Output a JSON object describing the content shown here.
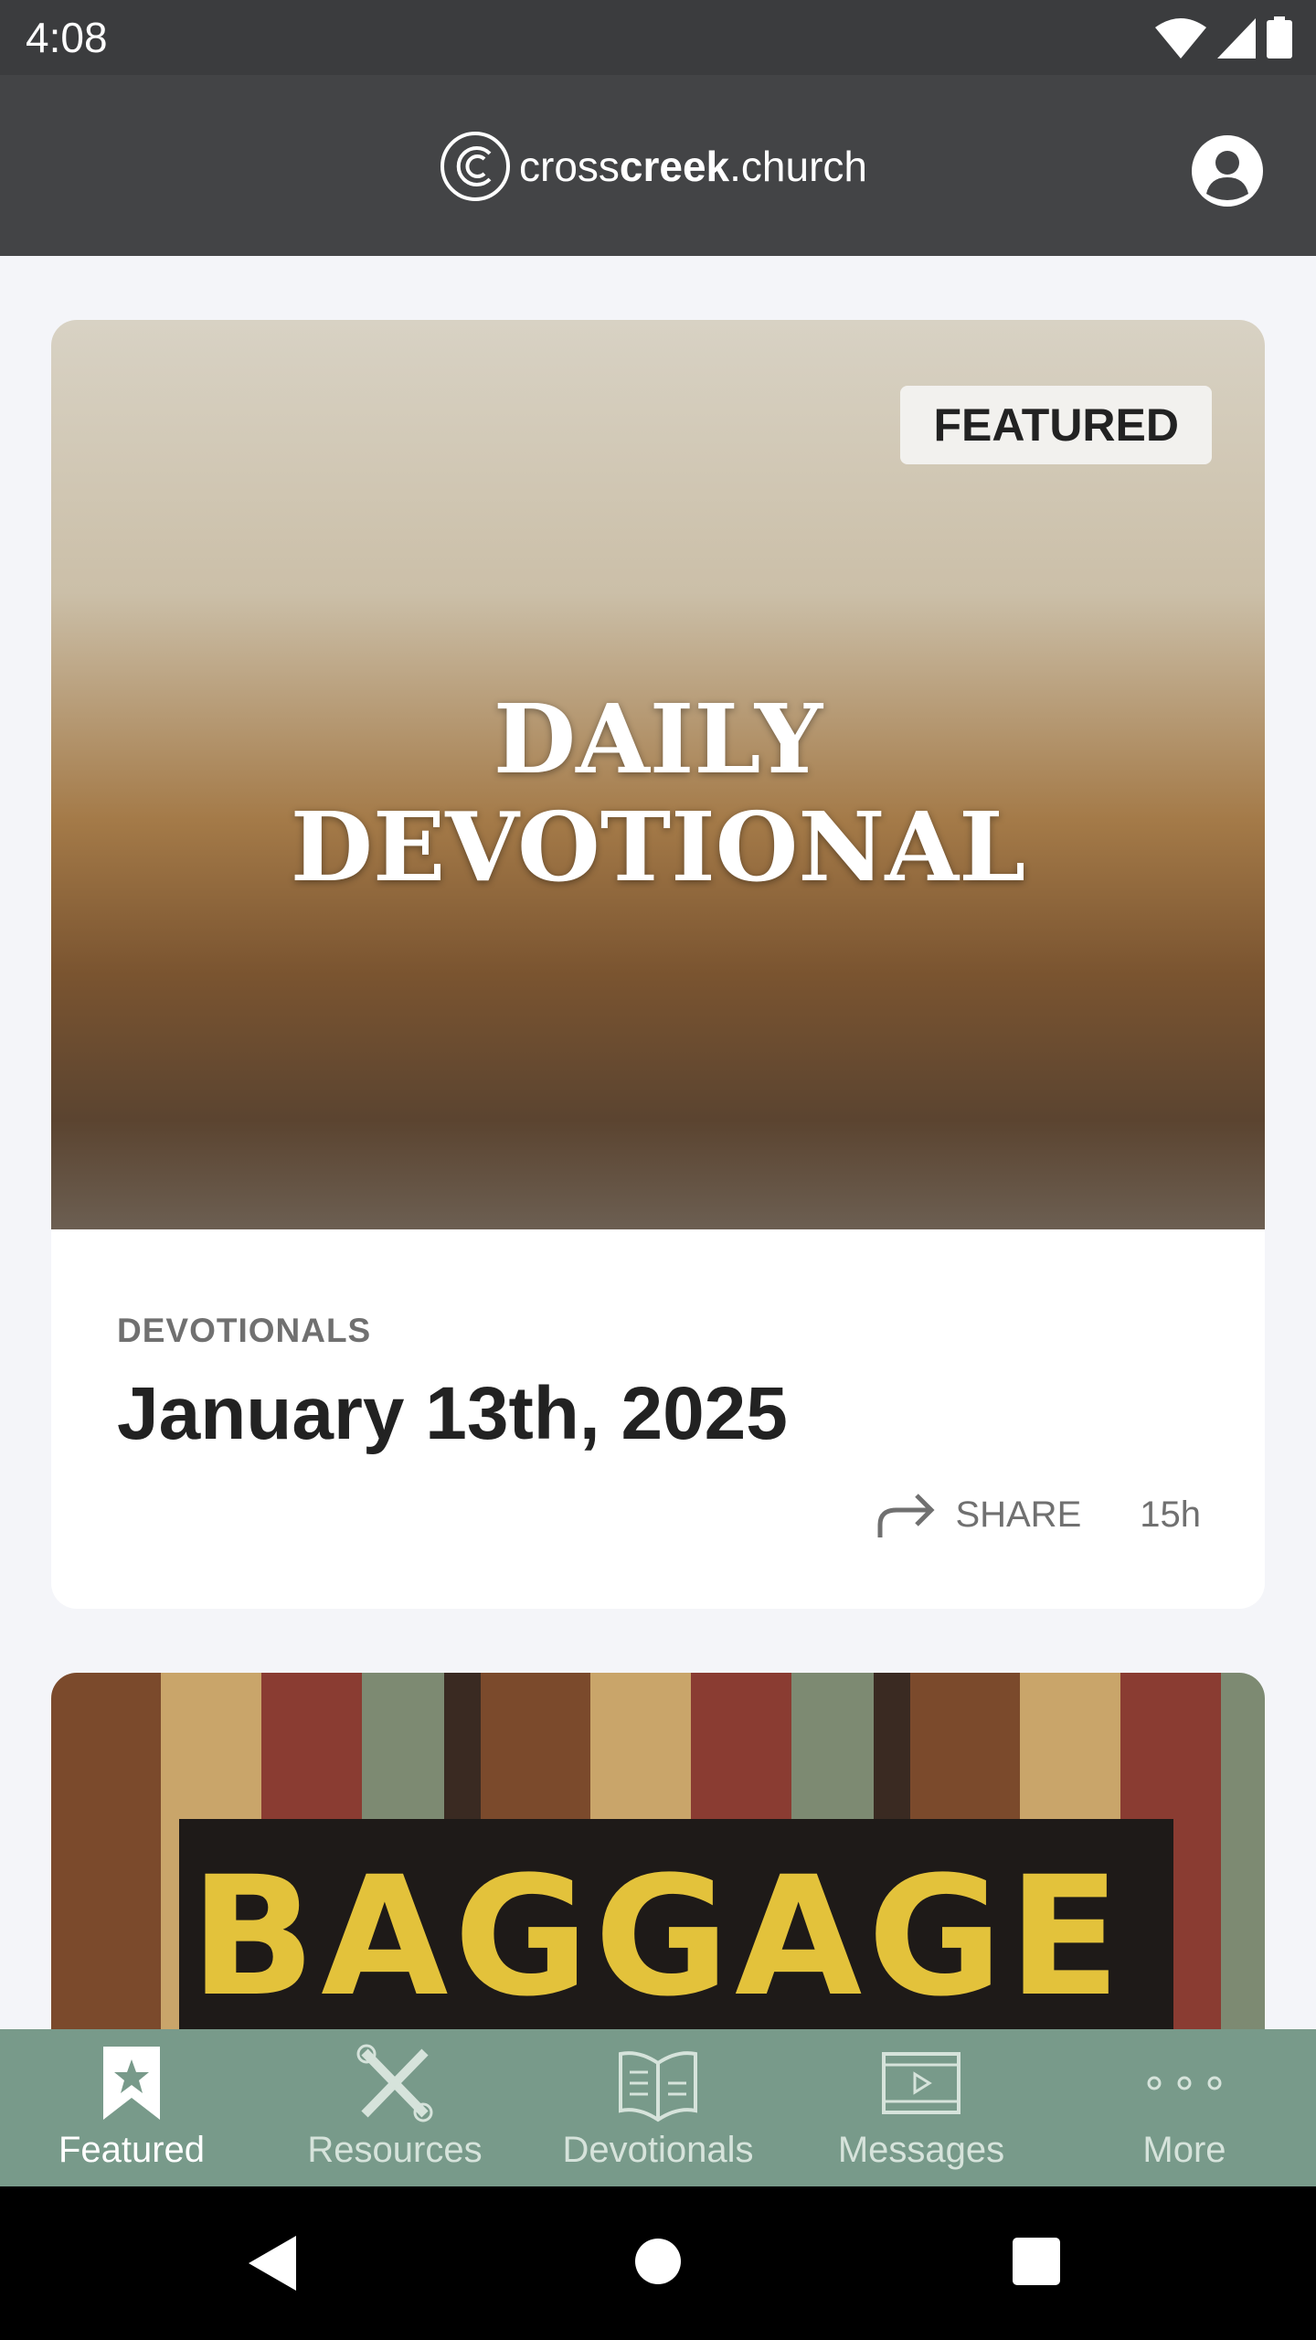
{
  "status_bar": {
    "time": "4:08"
  },
  "header": {
    "logo_text_light": "cross",
    "logo_text_bold": "creek",
    "logo_text_suffix": ".church"
  },
  "feed": [
    {
      "image_title_line1": "DAILY",
      "image_title_line2": "DEVOTIONAL",
      "badge": "FEATURED",
      "category": "DEVOTIONALS",
      "title": "January 13th, 2025",
      "share_label": "SHARE",
      "age": "15h"
    },
    {
      "image_title": "BAGGAGE"
    }
  ],
  "bottom_nav": {
    "active": "Featured",
    "items": [
      {
        "label": "Featured",
        "icon": "bookmark-star-icon"
      },
      {
        "label": "Resources",
        "icon": "tools-icon"
      },
      {
        "label": "Devotionals",
        "icon": "book-icon"
      },
      {
        "label": "Messages",
        "icon": "film-play-icon"
      },
      {
        "label": "More",
        "icon": "more-dots-icon"
      }
    ]
  },
  "colors": {
    "header": "#434446",
    "nav": "#789a8a",
    "background": "#f4f5f9"
  }
}
